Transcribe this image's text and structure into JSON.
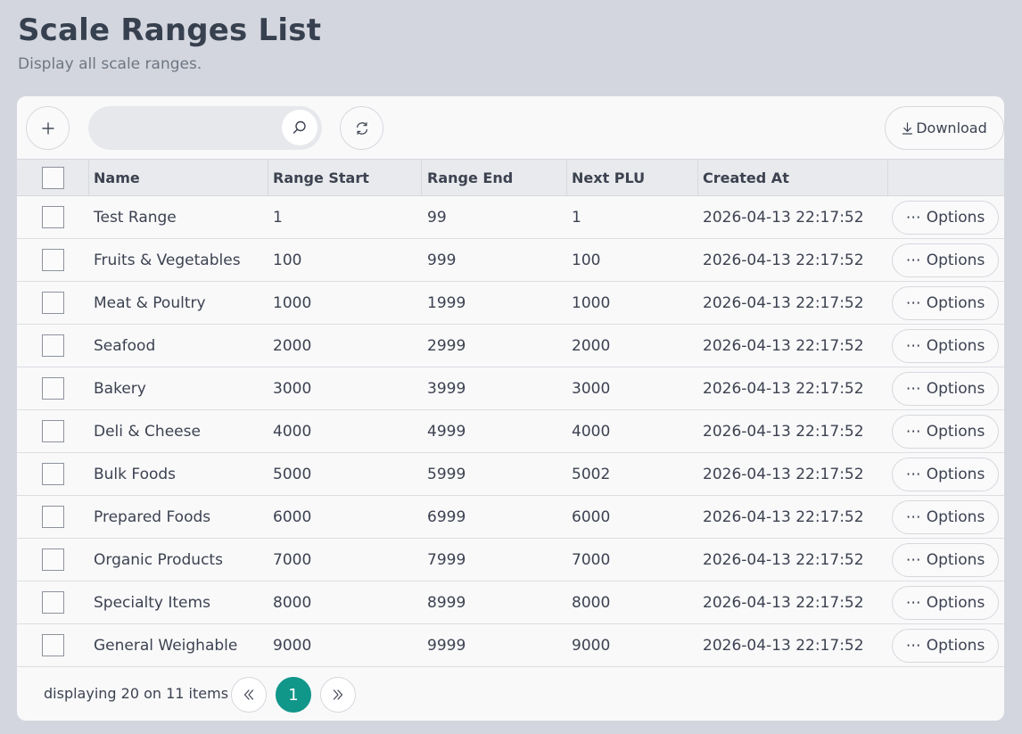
{
  "page": {
    "title": "Scale Ranges List",
    "subtitle": "Display all scale ranges."
  },
  "toolbar": {
    "add_icon": "plus-icon",
    "search_placeholder": "",
    "search_value": "",
    "search_icon": "search-icon",
    "refresh_icon": "refresh-icon",
    "download_label": "Download",
    "download_icon": "download-icon"
  },
  "table": {
    "headers": {
      "name": "Name",
      "range_start": "Range Start",
      "range_end": "Range End",
      "next_plu": "Next PLU",
      "created_at": "Created At"
    },
    "options_label": "Options",
    "rows": [
      {
        "name": "Test Range",
        "range_start": "1",
        "range_end": "99",
        "next_plu": "1",
        "created_at": "2026-04-13 22:17:52"
      },
      {
        "name": "Fruits & Vegetables",
        "range_start": "100",
        "range_end": "999",
        "next_plu": "100",
        "created_at": "2026-04-13 22:17:52"
      },
      {
        "name": "Meat & Poultry",
        "range_start": "1000",
        "range_end": "1999",
        "next_plu": "1000",
        "created_at": "2026-04-13 22:17:52"
      },
      {
        "name": "Seafood",
        "range_start": "2000",
        "range_end": "2999",
        "next_plu": "2000",
        "created_at": "2026-04-13 22:17:52"
      },
      {
        "name": "Bakery",
        "range_start": "3000",
        "range_end": "3999",
        "next_plu": "3000",
        "created_at": "2026-04-13 22:17:52"
      },
      {
        "name": "Deli & Cheese",
        "range_start": "4000",
        "range_end": "4999",
        "next_plu": "4000",
        "created_at": "2026-04-13 22:17:52"
      },
      {
        "name": "Bulk Foods",
        "range_start": "5000",
        "range_end": "5999",
        "next_plu": "5002",
        "created_at": "2026-04-13 22:17:52"
      },
      {
        "name": "Prepared Foods",
        "range_start": "6000",
        "range_end": "6999",
        "next_plu": "6000",
        "created_at": "2026-04-13 22:17:52"
      },
      {
        "name": "Organic Products",
        "range_start": "7000",
        "range_end": "7999",
        "next_plu": "7000",
        "created_at": "2026-04-13 22:17:52"
      },
      {
        "name": "Specialty Items",
        "range_start": "8000",
        "range_end": "8999",
        "next_plu": "8000",
        "created_at": "2026-04-13 22:17:52"
      },
      {
        "name": "General Weighable",
        "range_start": "9000",
        "range_end": "9999",
        "next_plu": "9000",
        "created_at": "2026-04-13 22:17:52"
      }
    ]
  },
  "pagination": {
    "summary": "displaying 20 on 11 items",
    "current_page": "1",
    "prev_icon": "double-chevron-left-icon",
    "next_icon": "double-chevron-right-icon"
  },
  "colors": {
    "background": "#d3d6de",
    "card": "#f9f9fa",
    "accent": "#11968a"
  }
}
